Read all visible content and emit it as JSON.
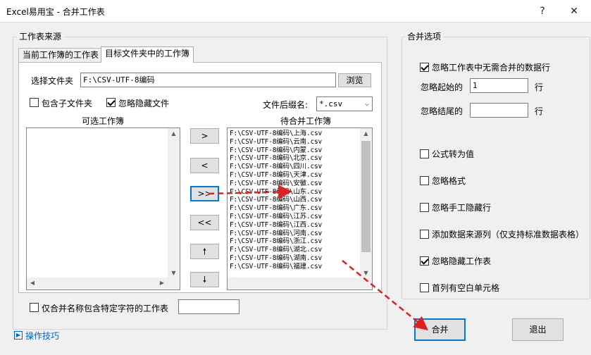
{
  "window": {
    "title": "Excel易用宝 - 合并工作表",
    "help_glyph": "?",
    "close_glyph": "✕"
  },
  "source_group": {
    "legend": "工作表来源",
    "tabs": [
      {
        "label": "当前工作簿的工作表",
        "active": false
      },
      {
        "label": "目标文件夹中的工作簿",
        "active": true
      }
    ],
    "folder_label": "选择文件夹",
    "folder_value": "F:\\CSV-UTF-8编码",
    "browse_label": "浏览",
    "include_subfolders": {
      "label": "包含子文件夹",
      "checked": false
    },
    "ignore_hidden_files": {
      "label": "忽略隐藏文件",
      "checked": true
    },
    "extension_label": "文件后缀名:",
    "extension_value": "*.csv",
    "available_label": "可选工作簿",
    "pending_label": "待合并工作簿",
    "pending_items": [
      "F:\\CSV-UTF-8编码\\上海.csv",
      "F:\\CSV-UTF-8编码\\云南.csv",
      "F:\\CSV-UTF-8编码\\内蒙.csv",
      "F:\\CSV-UTF-8编码\\北京.csv",
      "F:\\CSV-UTF-8编码\\四川.csv",
      "F:\\CSV-UTF-8编码\\天津.csv",
      "F:\\CSV-UTF-8编码\\安徽.csv",
      "F:\\CSV-UTF-8编码\\山东.csv",
      "F:\\CSV-UTF-8编码\\山西.csv",
      "F:\\CSV-UTF-8编码\\广东.csv",
      "F:\\CSV-UTF-8编码\\江苏.csv",
      "F:\\CSV-UTF-8编码\\江西.csv",
      "F:\\CSV-UTF-8编码\\河南.csv",
      "F:\\CSV-UTF-8编码\\浙江.csv",
      "F:\\CSV-UTF-8编码\\湖北.csv",
      "F:\\CSV-UTF-8编码\\湖南.csv",
      "F:\\CSV-UTF-8编码\\福建.csv"
    ],
    "move_buttons": {
      "add_one": ">",
      "remove_one": "<",
      "add_all": ">>",
      "remove_all": "<<",
      "move_up": "🠕",
      "move_down": "🠗"
    },
    "name_filter": {
      "label": "仅合并名称包含特定字符的工作表",
      "checked": false,
      "value": ""
    }
  },
  "options_group": {
    "legend": "合并选项",
    "ignore_unneeded_rows": {
      "label": "忽略工作表中无需合并的数据行",
      "checked": true
    },
    "ignore_start_label": "忽略起始的",
    "ignore_start_value": "1",
    "ignore_end_label": "忽略结尾的",
    "ignore_end_value": "",
    "row_unit": "行",
    "formula_to_value": {
      "label": "公式转为值",
      "checked": false
    },
    "ignore_format": {
      "label": "忽略格式",
      "checked": false
    },
    "ignore_manual_hidden_rows": {
      "label": "忽略手工隐藏行",
      "checked": false
    },
    "add_source_column": {
      "label": "添加数据来源列（仅支持标准数据表格）",
      "checked": false
    },
    "ignore_hidden_sheets": {
      "label": "忽略隐藏工作表",
      "checked": true
    },
    "blank_first_column": {
      "label": "首列有空白单元格",
      "checked": false
    }
  },
  "footer": {
    "tips_label": "操作技巧",
    "merge_label": "合并",
    "exit_label": "退出"
  },
  "colors": {
    "annotation_arrow": "#e02020",
    "accent": "#0078d7"
  }
}
